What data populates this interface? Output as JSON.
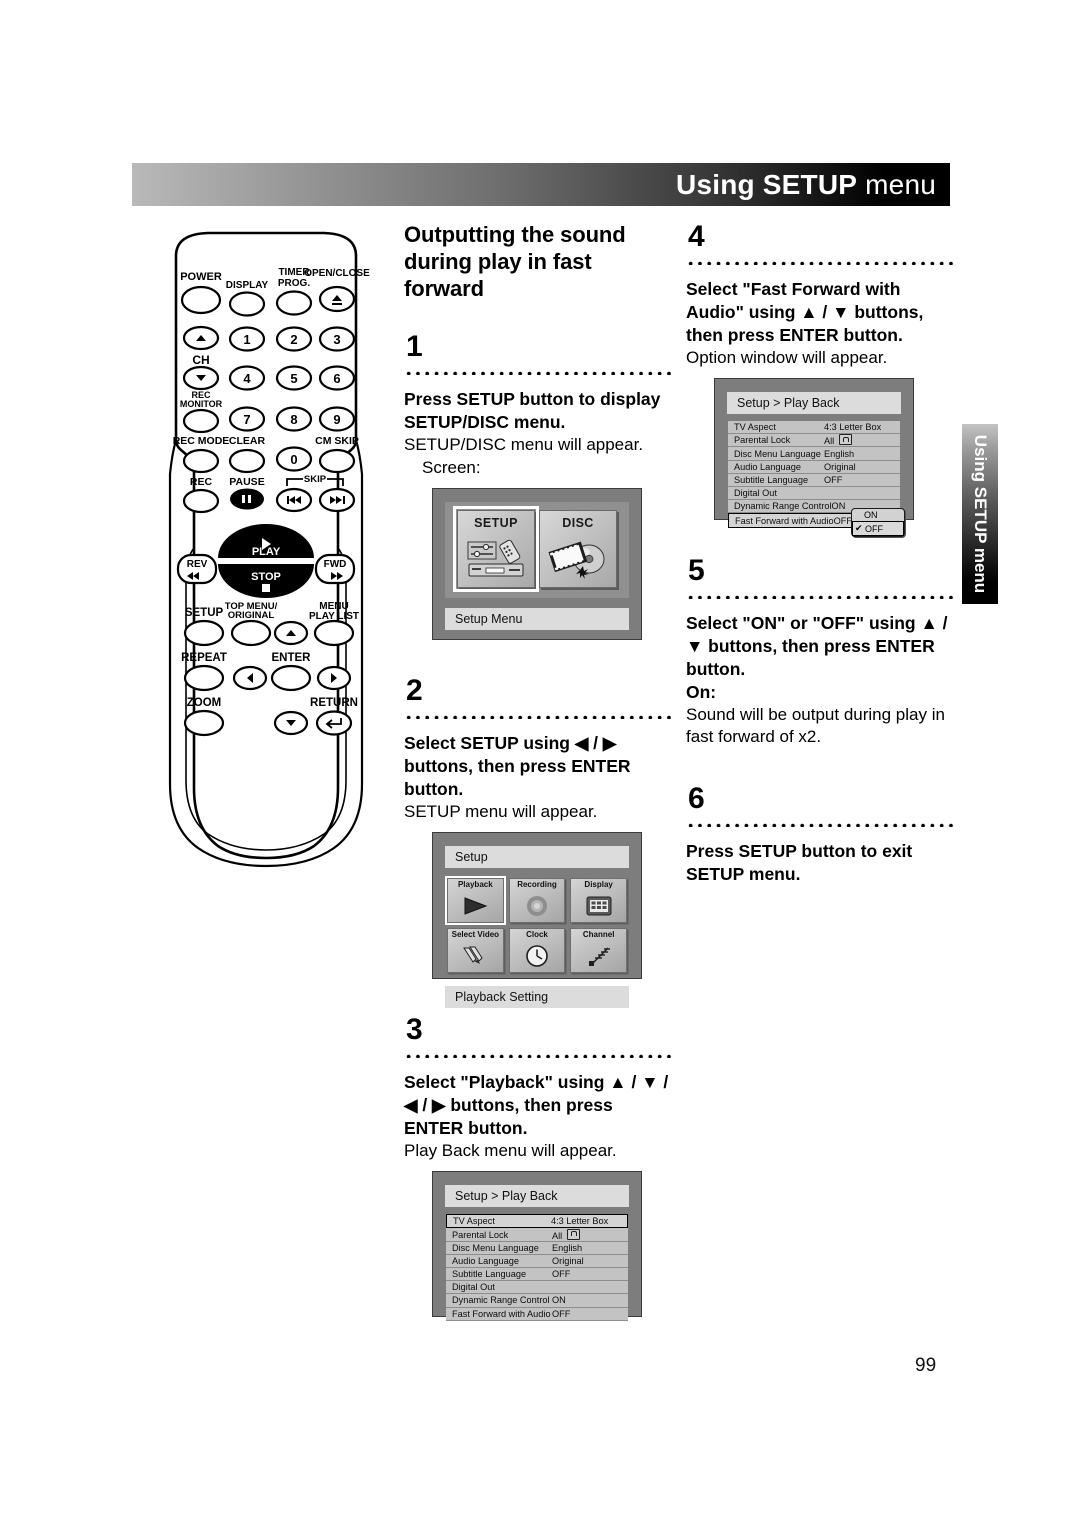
{
  "header": {
    "title_bold": "Using SETUP",
    "title_light": " menu"
  },
  "side_tab": {
    "label": "Using SETUP menu"
  },
  "page": {
    "number": "99"
  },
  "section": {
    "title": "Outputting the sound during play in fast forward"
  },
  "steps": [
    {
      "number": "1",
      "bold": "Press SETUP button to display SETUP/DISC menu.",
      "plain": "SETUP/DISC menu will appear.",
      "sub": "Screen:"
    },
    {
      "number": "2",
      "bold": "Select SETUP using ◀ / ▶ buttons, then press ENTER button.",
      "plain": "SETUP menu will appear."
    },
    {
      "number": "3",
      "bold": "Select \"Playback\" using ▲ / ▼ / ◀ / ▶ buttons, then press ENTER button.",
      "plain": "Play Back menu will appear."
    },
    {
      "number": "4",
      "bold": "Select \"Fast Forward with Audio\" using ▲ / ▼ buttons, then press ENTER button.",
      "plain": "Option window will appear."
    },
    {
      "number": "5",
      "bold": "Select \"ON\" or \"OFF\" using ▲ / ▼ buttons, then press ENTER button.",
      "bold2": "On:",
      "plain": "Sound will be output during play in fast forward of x2."
    },
    {
      "number": "6",
      "bold": "Press SETUP button to exit SETUP menu."
    }
  ],
  "screens": {
    "setup_disc": {
      "tiles": [
        {
          "label": "SETUP",
          "icon": "equalizer-remote-deck-icon",
          "selected": true
        },
        {
          "label": "DISC",
          "icon": "film-disc-icon",
          "selected": false
        }
      ],
      "caption": "Setup Menu"
    },
    "setup_menu": {
      "title": "Setup",
      "cells": [
        {
          "label": "Playback",
          "icon": "play-triangle-icon",
          "selected": true
        },
        {
          "label": "Recording",
          "icon": "record-circle-icon",
          "selected": false
        },
        {
          "label": "Display",
          "icon": "monitor-icon",
          "selected": false
        },
        {
          "label": "Select Video",
          "icon": "cables-icon",
          "selected": false
        },
        {
          "label": "Clock",
          "icon": "clock-icon",
          "selected": false
        },
        {
          "label": "Channel",
          "icon": "antenna-icon",
          "selected": false
        }
      ],
      "caption": "Playback Setting"
    },
    "play_back": {
      "title": "Setup > Play Back",
      "rows": [
        {
          "label": "TV Aspect",
          "value": "4:3 Letter Box",
          "highlighted": true
        },
        {
          "label": "Parental Lock",
          "value": "All",
          "lock_icon": true
        },
        {
          "label": "Disc Menu Language",
          "value": "English"
        },
        {
          "label": "Audio Language",
          "value": "Original"
        },
        {
          "label": "Subtitle Language",
          "value": "OFF"
        },
        {
          "label": "Digital Out",
          "value": ""
        },
        {
          "label": "Dynamic Range Control",
          "value": "ON"
        },
        {
          "label": "Fast Forward with Audio",
          "value": "OFF"
        }
      ]
    },
    "play_back_option": {
      "title": "Setup > Play Back",
      "rows": [
        {
          "label": "TV Aspect",
          "value": "4:3 Letter Box"
        },
        {
          "label": "Parental Lock",
          "value": "All",
          "lock_icon": true
        },
        {
          "label": "Disc Menu Language",
          "value": "English"
        },
        {
          "label": "Audio Language",
          "value": "Original"
        },
        {
          "label": "Subtitle Language",
          "value": "OFF"
        },
        {
          "label": "Digital Out",
          "value": ""
        },
        {
          "label": "Dynamic Range Control",
          "value": "ON"
        },
        {
          "label": "Fast Forward with Audio",
          "value": "OFF",
          "highlighted": true
        }
      ],
      "popup": {
        "options": [
          "ON",
          "OFF"
        ],
        "checked": "OFF",
        "check_glyph": "✔"
      }
    }
  },
  "remote": {
    "buttons": [
      {
        "name": "power",
        "label": "POWER"
      },
      {
        "name": "display",
        "label": "DISPLAY"
      },
      {
        "name": "timer-prog",
        "label": "TIMER PROG."
      },
      {
        "name": "open-close",
        "label": "OPEN/CLOSE"
      },
      {
        "name": "ch-up",
        "label": ""
      },
      {
        "name": "num-1",
        "label": "1"
      },
      {
        "name": "num-2",
        "label": "2"
      },
      {
        "name": "num-3",
        "label": "3"
      },
      {
        "name": "ch",
        "label": "CH"
      },
      {
        "name": "num-4",
        "label": "4"
      },
      {
        "name": "num-5",
        "label": "5"
      },
      {
        "name": "num-6",
        "label": "6"
      },
      {
        "name": "rec-monitor",
        "label": "REC MONITOR"
      },
      {
        "name": "num-7",
        "label": "7"
      },
      {
        "name": "num-8",
        "label": "8"
      },
      {
        "name": "num-9",
        "label": "9"
      },
      {
        "name": "rec-mode",
        "label": "REC MODE"
      },
      {
        "name": "clear",
        "label": "CLEAR"
      },
      {
        "name": "num-0",
        "label": "0"
      },
      {
        "name": "cm-skip",
        "label": "CM SKIP"
      },
      {
        "name": "rec",
        "label": "REC"
      },
      {
        "name": "pause",
        "label": "PAUSE"
      },
      {
        "name": "skip",
        "label": "SKIP"
      },
      {
        "name": "play",
        "label": "PLAY"
      },
      {
        "name": "stop",
        "label": "STOP"
      },
      {
        "name": "rev",
        "label": "REV"
      },
      {
        "name": "fwd",
        "label": "FWD"
      },
      {
        "name": "setup",
        "label": "SETUP"
      },
      {
        "name": "top-menu-original",
        "label": "TOP MENU/ ORIGINAL"
      },
      {
        "name": "menu-play-list",
        "label": "MENU PLAY LIST"
      },
      {
        "name": "repeat",
        "label": "REPEAT"
      },
      {
        "name": "enter",
        "label": "ENTER"
      },
      {
        "name": "zoom",
        "label": "ZOOM"
      },
      {
        "name": "return",
        "label": "RETURN"
      }
    ],
    "labels": {
      "power": "POWER",
      "display": "DISPLAY",
      "timer": "TIMER",
      "prog": "PROG.",
      "open_close": "OPEN/CLOSE",
      "ch": "CH",
      "rec": "REC",
      "monitor": "MONITOR",
      "rec_mode": "REC MODE",
      "clear": "CLEAR",
      "cm_skip": "CM SKIP",
      "rec_btn": "REC",
      "pause": "PAUSE",
      "skip": "SKIP",
      "play": "PLAY",
      "stop": "STOP",
      "rev": "REV",
      "fwd": "FWD",
      "setup": "SETUP",
      "top_menu": "TOP MENU/",
      "original": "ORIGINAL",
      "menu": "MENU",
      "play_list": "PLAY LIST",
      "repeat": "REPEAT",
      "enter": "ENTER",
      "zoom": "ZOOM",
      "return": "RETURN",
      "n1": "1",
      "n2": "2",
      "n3": "3",
      "n4": "4",
      "n5": "5",
      "n6": "6",
      "n7": "7",
      "n8": "8",
      "n9": "9",
      "n0": "0"
    }
  }
}
